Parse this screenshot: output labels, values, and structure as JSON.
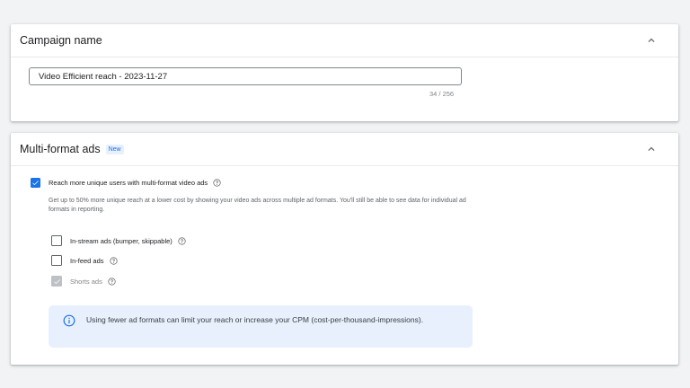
{
  "campaign_name_section": {
    "title": "Campaign name",
    "input_value": "Video Efficient reach - 2023-11-27",
    "counter": "34 / 256",
    "collapse_icon": "chevron-up-icon"
  },
  "multi_format_section": {
    "title": "Multi-format ads",
    "badge": "New",
    "collapse_icon": "chevron-up-icon",
    "main_checkbox": {
      "label": "Reach more unique users with multi-format video ads",
      "checked": true
    },
    "description": "Get up to 50% more unique reach at a lower cost by showing your video ads across multiple ad formats. You'll still be able to see data for individual ad formats in reporting.",
    "formats": [
      {
        "label": "In-stream ads (bumper, skippable)",
        "checked": false,
        "disabled": false
      },
      {
        "label": "In-feed ads",
        "checked": false,
        "disabled": false
      },
      {
        "label": "Shorts ads",
        "checked": true,
        "disabled": true
      }
    ],
    "info_text": "Using fewer ad formats can limit your reach or increase your CPM (cost-per-thousand-impressions)."
  },
  "colors": {
    "accent": "#1a73e8",
    "info_bg": "#e8f0fe",
    "disabled": "#bdc1c6",
    "page_bg": "#f1f3f4"
  }
}
